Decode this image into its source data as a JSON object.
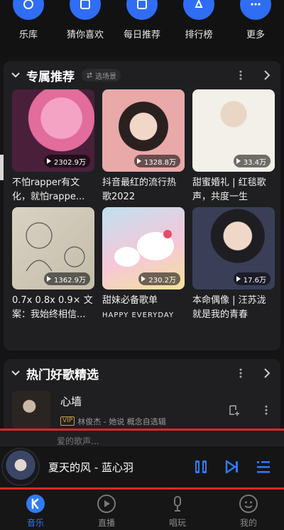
{
  "quick_nav": [
    {
      "label": "乐库",
      "icon": "library-icon"
    },
    {
      "label": "猜你喜欢",
      "icon": "like-icon"
    },
    {
      "label": "每日推荐",
      "icon": "calendar-icon"
    },
    {
      "label": "排行榜",
      "icon": "ranking-icon"
    },
    {
      "label": "更多",
      "icon": "more-icon"
    }
  ],
  "recommend": {
    "title": "专属推荐",
    "chip_label": "选场景",
    "playlists": [
      {
        "title": "不怕rapper有文化，就怕rappe...",
        "plays": "2302.9万"
      },
      {
        "title": "抖音最红的流行热歌2022",
        "plays": "1328.8万"
      },
      {
        "title": "甜蜜婚礼 | 红毯歌声，共度一生",
        "plays": "33.4万"
      },
      {
        "title": "0.7x 0.8x 0.9× 文案：我始终相信...",
        "plays": "1362.9万"
      },
      {
        "title": "甜妹必备歌单",
        "plays": "230.2万",
        "cover_text": "HAPPY EVERYDAY"
      },
      {
        "title": "本命偶像 | 汪苏泷就是我的青春",
        "plays": "17.6万"
      }
    ]
  },
  "hot_songs": {
    "title": "热门好歌精选",
    "songs": [
      {
        "title": "心墙",
        "vip": "VIP",
        "meta": "林俊杰 - 她说 概念自选辑"
      }
    ],
    "peek_title": "爱的歌声..."
  },
  "player": {
    "now_playing": "夏天的风 - 蓝心羽"
  },
  "tabs": [
    {
      "label": "音乐",
      "active": true,
      "icon": "music-k-icon"
    },
    {
      "label": "直播",
      "active": false,
      "icon": "live-icon"
    },
    {
      "label": "唱玩",
      "active": false,
      "icon": "mic-icon"
    },
    {
      "label": "我的",
      "active": false,
      "icon": "profile-icon"
    }
  ],
  "colors": {
    "accent": "#2f7bf5",
    "highlight_border": "#e2252b",
    "background": "#141414",
    "card": "#1f1f21"
  }
}
